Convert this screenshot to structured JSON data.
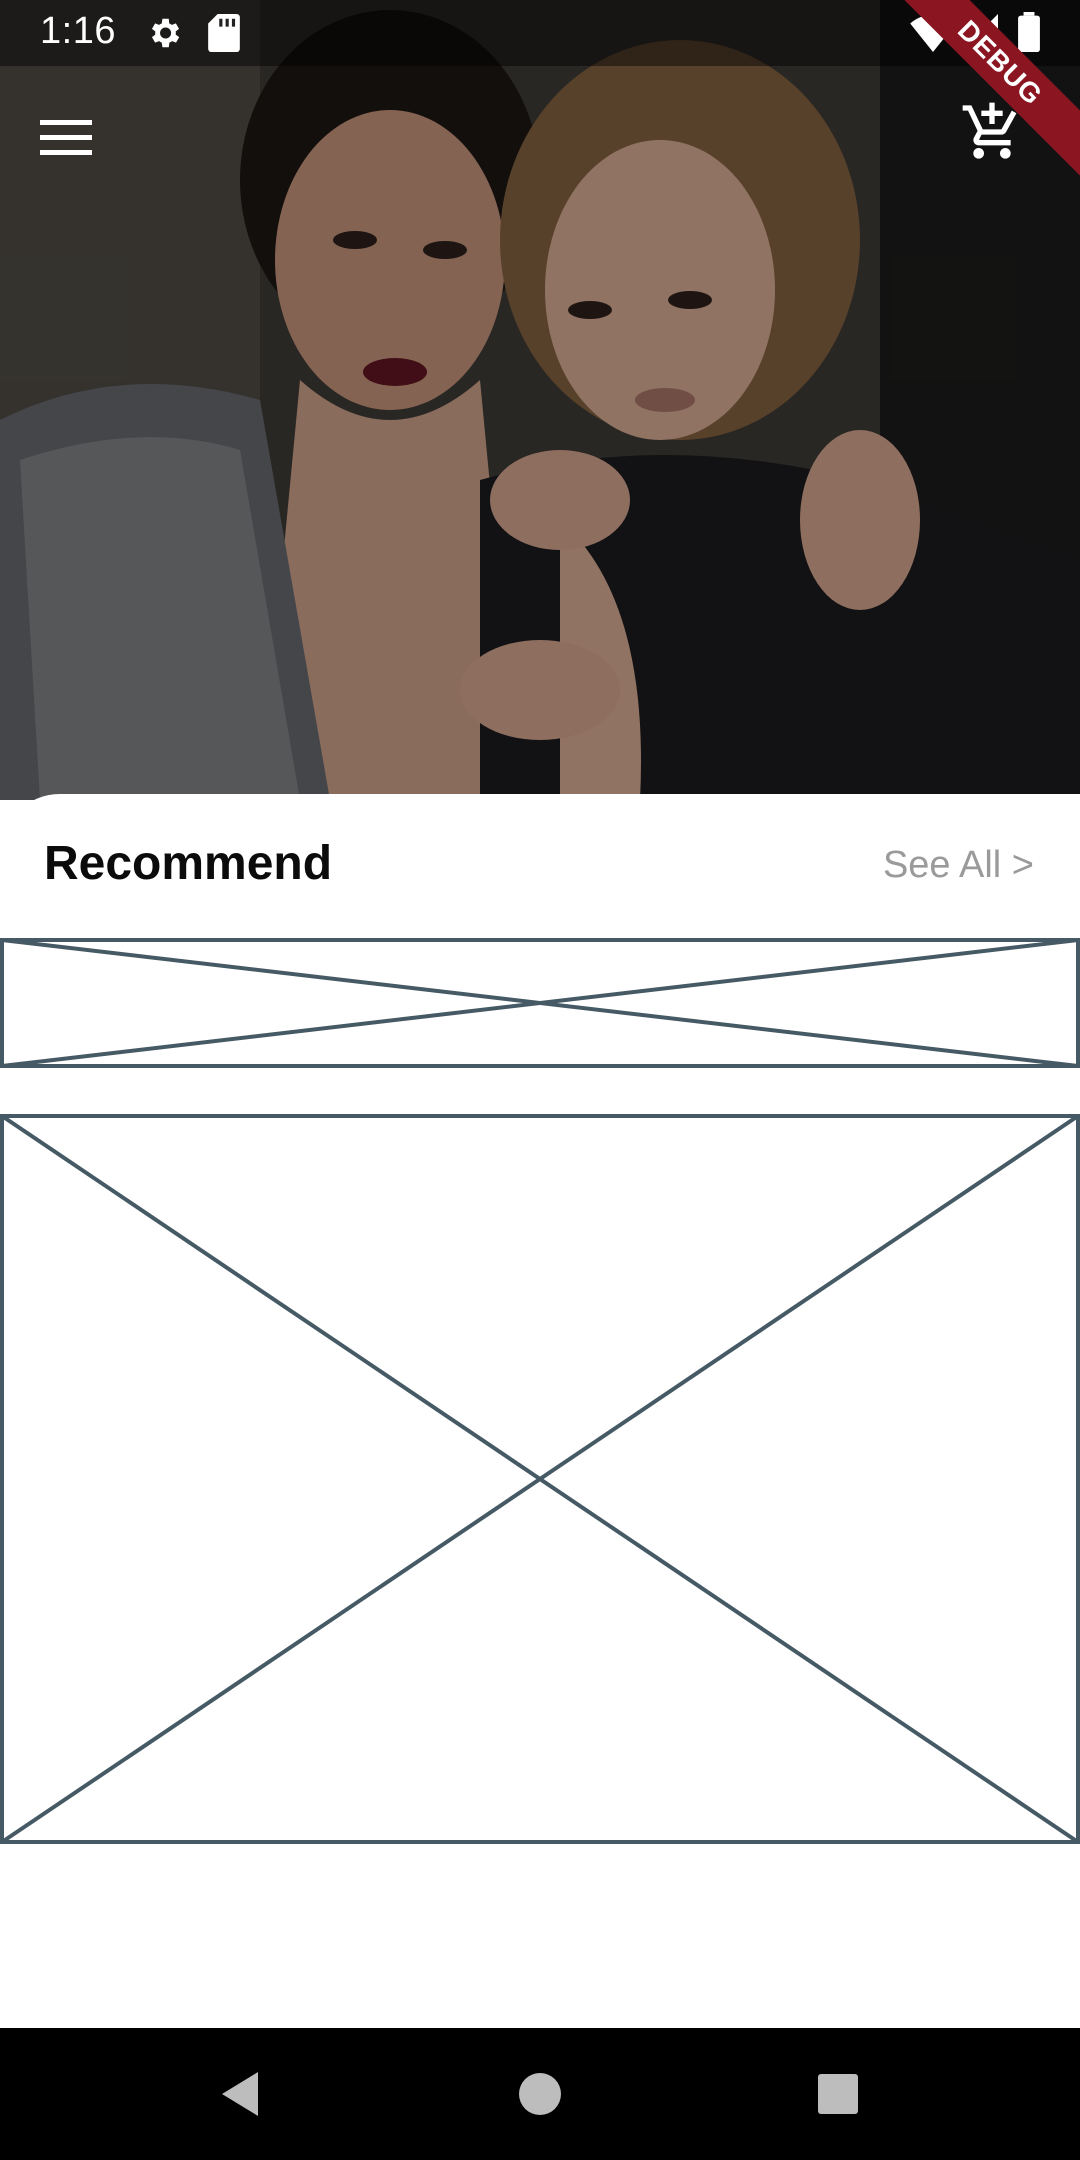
{
  "status_bar": {
    "time": "1:16",
    "icons": [
      "settings-icon",
      "sd-card-icon",
      "wifi-icon",
      "signal-icon",
      "battery-icon"
    ]
  },
  "app_bar": {
    "menu_icon": "menu-icon",
    "cart_icon": "add-shopping-cart-icon"
  },
  "debug_banner": "DEBUG",
  "recommend": {
    "title": "Recommend",
    "see_all": "See All >"
  },
  "nav_bar": {
    "icons": [
      "back-icon",
      "home-icon",
      "recents-icon"
    ]
  },
  "colors": {
    "placeholder_stroke": "#455a64",
    "debug_ribbon": "#8b1622",
    "see_all": "#9a9a9a"
  }
}
